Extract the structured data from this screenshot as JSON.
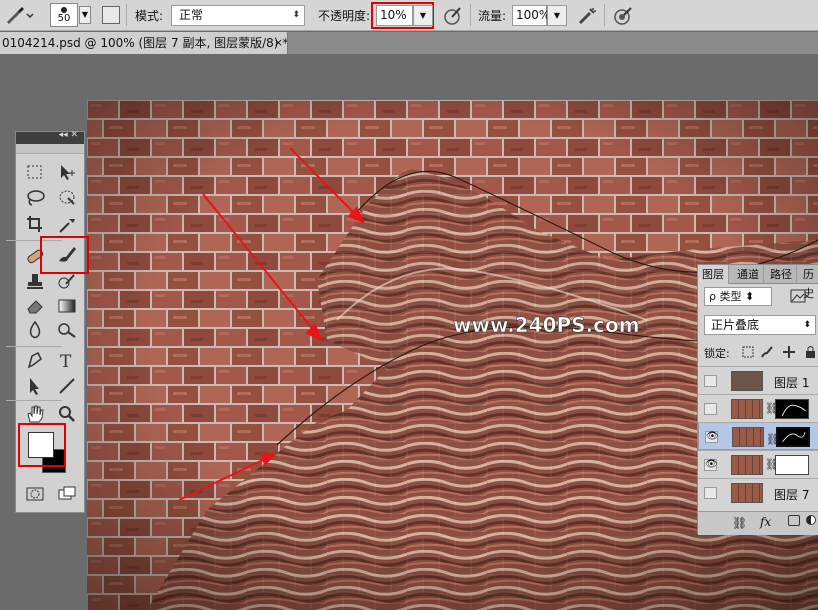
{
  "options_bar": {
    "brush_size": "50",
    "mode_label": "模式:",
    "mode_value": "正常",
    "opacity_label": "不透明度:",
    "opacity_value": "10%",
    "flow_label": "流量:",
    "flow_value": "100%"
  },
  "document": {
    "tab_title": "0104214.psd @ 100% (图层 7 副本, 图层蒙版/8) *",
    "close": "×"
  },
  "canvas": {
    "watermark": "www.240PS.com"
  },
  "layers_panel": {
    "tabs": [
      "图层",
      "通道",
      "路径",
      "历史"
    ],
    "kind_filter": "ρ 类型",
    "blend_mode": "正片叠底",
    "lock_label": "锁定:",
    "layers": [
      {
        "name": "图层 1",
        "visible": false,
        "has_mask": false,
        "selected": false
      },
      {
        "name": "",
        "visible": false,
        "has_mask": true,
        "selected": false
      },
      {
        "name": "",
        "visible": true,
        "has_mask": true,
        "selected": true
      },
      {
        "name": "",
        "visible": true,
        "has_mask": true,
        "selected": false
      },
      {
        "name": "图层 7",
        "visible": false,
        "has_mask": false,
        "selected": false
      }
    ],
    "footer_fx": "fx"
  },
  "colors": {
    "foreground": "#ffffff",
    "background": "#000000",
    "highlight": "#e00000",
    "selected_layer": "#b5c7e6"
  },
  "icons": [
    "brush-tool-icon",
    "marquee-icon",
    "move-icon",
    "lasso-icon",
    "quick-select-icon",
    "crop-icon",
    "eyedropper-icon",
    "healing-icon",
    "brush-icon",
    "stamp-icon",
    "history-brush-icon",
    "eraser-icon",
    "gradient-icon",
    "blur-icon",
    "dodge-icon",
    "pen-icon",
    "type-icon",
    "path-select-icon",
    "line-icon",
    "hand-icon",
    "zoom-icon"
  ]
}
